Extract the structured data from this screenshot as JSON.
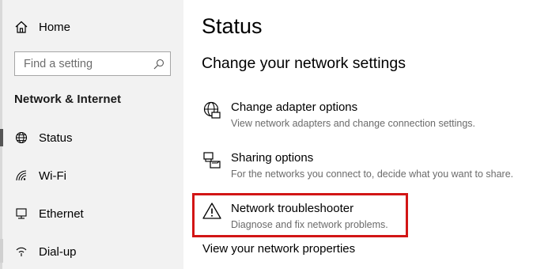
{
  "sidebar": {
    "home_label": "Home",
    "search_placeholder": "Find a setting",
    "section_title": "Network & Internet",
    "items": [
      {
        "label": "Status",
        "icon": "globe-icon",
        "selected": true
      },
      {
        "label": "Wi-Fi",
        "icon": "wifi-icon",
        "selected": false
      },
      {
        "label": "Ethernet",
        "icon": "ethernet-icon",
        "selected": false
      },
      {
        "label": "Dial-up",
        "icon": "dialup-icon",
        "selected": false
      }
    ]
  },
  "main": {
    "title": "Status",
    "subtitle": "Change your network settings",
    "options": [
      {
        "title": "Change adapter options",
        "desc": "View network adapters and change connection settings.",
        "icon": "adapter-icon"
      },
      {
        "title": "Sharing options",
        "desc": "For the networks you connect to, decide what you want to share.",
        "icon": "sharing-icon"
      },
      {
        "title": "Network troubleshooter",
        "desc": "Diagnose and fix network problems.",
        "icon": "warning-icon"
      }
    ],
    "view_properties": "View your network properties"
  },
  "colors": {
    "highlight": "#d21515",
    "sidebar_bg": "#f2f2f2"
  }
}
